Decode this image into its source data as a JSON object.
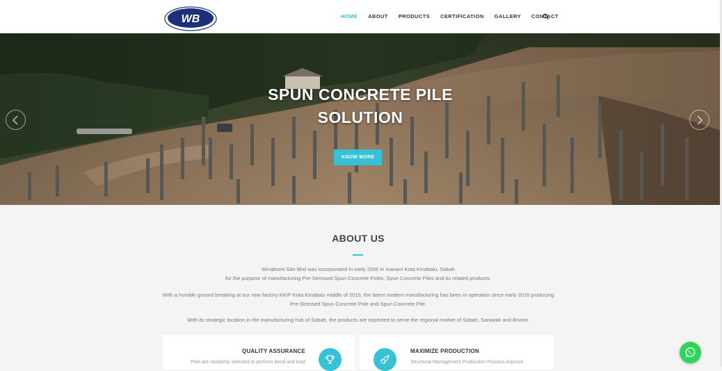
{
  "header": {
    "logo_text": "WB",
    "nav": [
      {
        "label": "HOME",
        "active": true
      },
      {
        "label": "ABOUT"
      },
      {
        "label": "PRODUCTS"
      },
      {
        "label": "CERTIFICATION"
      },
      {
        "label": "GALLERY"
      },
      {
        "label": "CONTACT"
      }
    ],
    "search_icon": "search-icon"
  },
  "hero": {
    "title_line1": "SPUN CONCRETE PILE",
    "title_line2": "SOLUTION",
    "button_label": "KNOW MORE",
    "prev_icon": "chevron-left-icon",
    "next_icon": "chevron-right-icon"
  },
  "about": {
    "title": "ABOUT US",
    "p1_line1": "Winabumi Sdn Bhd was incorporated in early 2006 in Inanam Kota Kinabalu, Sabah",
    "p1_line2": "for the purpose of manufacturing Pre-Stressed Spun Concrete Poles, Spun Concrete Piles and its related products.",
    "p2_line1": "With a humble ground breaking at our new factory KKIP Kota Kinabalu middle of 2015, the latest modern manufacturing has been in operation since early 2016 producing",
    "p2_line2": "Pre-Stressed Spun Concrete Pole and Spun Concrete Pile.",
    "p3": "With its strategic location in the manufacturing hub of Sabah, the products are expected to serve the regional market of Sabah, Sarawak and Brunei.",
    "cards": [
      {
        "title": "QUALITY ASSURANCE",
        "desc": "Pole are randomly selected to perform bend and load",
        "icon": "trophy-icon"
      },
      {
        "title": "MAXIMIZE PRODUCTION",
        "desc": "Structural Management Production Process improve",
        "icon": "rocket-icon"
      }
    ]
  },
  "colors": {
    "accent": "#35c1d6",
    "whatsapp": "#2ed457",
    "logo_blue": "#1d2f7a"
  },
  "whatsapp_icon": "whatsapp-icon"
}
